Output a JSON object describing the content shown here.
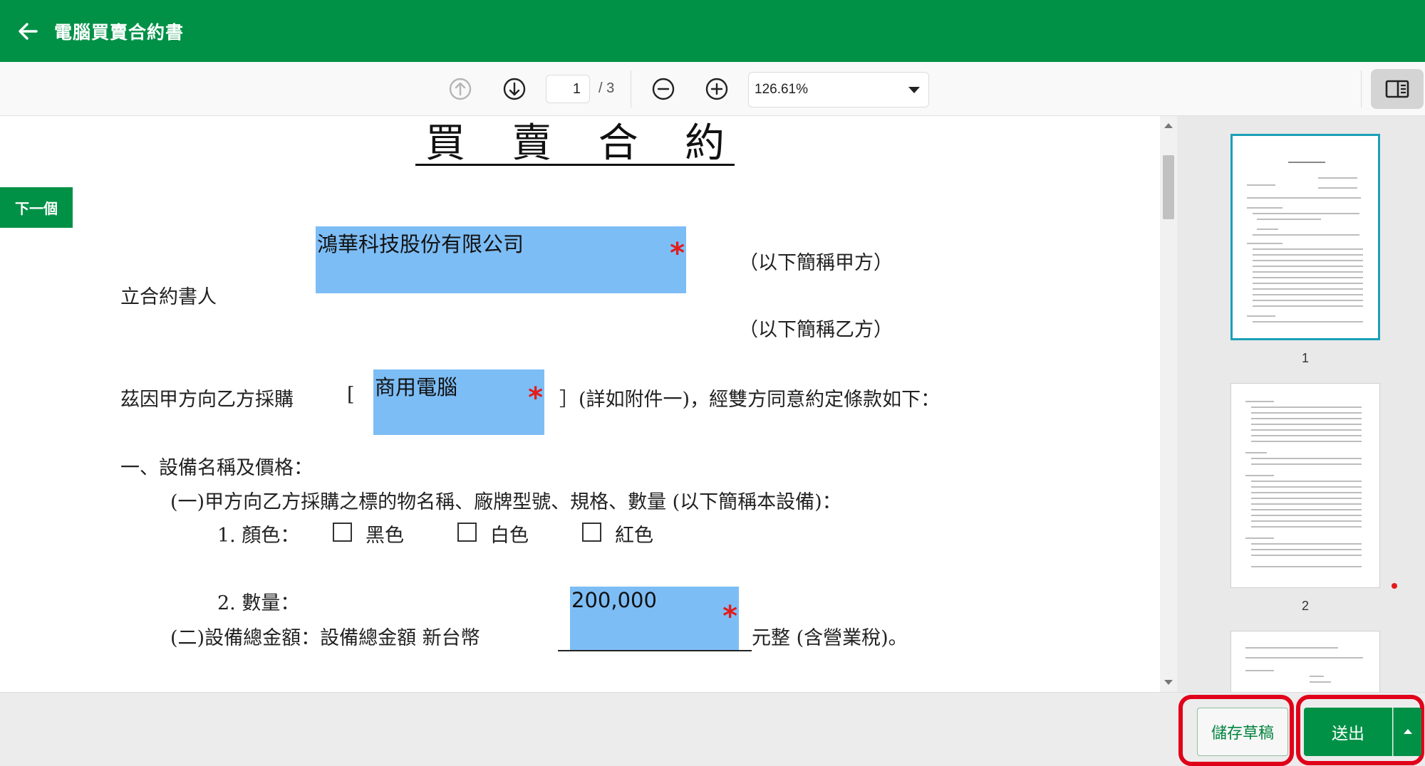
{
  "header": {
    "title": "電腦買賣合約書"
  },
  "toolbar": {
    "current_page": "1",
    "total_pages": "/ 3",
    "zoom": "126.61%"
  },
  "nav": {
    "next_label": "下一個"
  },
  "document": {
    "title_chars": [
      "買",
      "賣",
      "合",
      "約"
    ],
    "party_label": "立合約書人",
    "party_a_suffix": "（以下簡稱甲方）",
    "party_b_suffix": "（以下簡稱乙方）",
    "purchase_prefix": "茲因甲方向乙方採購",
    "bracket_open": "[",
    "purchase_suffix": "］(詳如附件一)，經雙方同意約定條款如下：",
    "section1": "一、設備名稱及價格：",
    "item1": "(一)甲方向乙方採購之標的物名稱、廠牌型號、規格、數量 (以下簡稱本設備)：",
    "color_label": "1. 顏色：",
    "color_options": [
      "黑色",
      "白色",
      "紅色"
    ],
    "qty_label": "2. 數量：",
    "amount_label": "(二)設備總金額：設備總金額 新台幣",
    "amount_suffix": "元整 (含營業稅)。",
    "fields": {
      "party_a": "鴻華科技股份有限公司",
      "product": "商用電腦",
      "amount": "200,000"
    }
  },
  "thumbnails": [
    "1",
    "2"
  ],
  "actions": {
    "draft": "儲存草稿",
    "submit": "送出"
  },
  "colors": {
    "brand_green": "#009147",
    "field_blue": "#7dbdf5",
    "required_red": "#e31b1b",
    "highlight_red": "#e0001a"
  }
}
